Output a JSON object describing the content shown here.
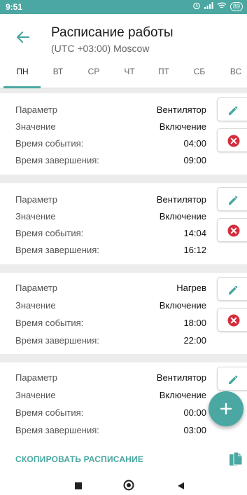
{
  "status": {
    "time": "9:51",
    "battery": "89"
  },
  "header": {
    "title": "Расписание работы",
    "subtitle": "(UTC +03:00) Moscow"
  },
  "tabs": [
    {
      "label": "ПН",
      "active": true
    },
    {
      "label": "ВТ"
    },
    {
      "label": "СР"
    },
    {
      "label": "ЧТ"
    },
    {
      "label": "ПТ"
    },
    {
      "label": "СБ"
    },
    {
      "label": "ВС"
    }
  ],
  "labels": {
    "param": "Параметр",
    "value": "Значение",
    "event_time": "Время события:",
    "end_time": "Время завершения:"
  },
  "events": [
    {
      "param": "Вентилятор",
      "value": "Включение",
      "event_time": "04:00",
      "end_time": "09:00"
    },
    {
      "param": "Вентилятор",
      "value": "Включение",
      "event_time": "14:04",
      "end_time": "16:12"
    },
    {
      "param": "Нагрев",
      "value": "Включение",
      "event_time": "18:00",
      "end_time": "22:00"
    },
    {
      "param": "Вентилятор",
      "value": "Включение",
      "event_time": "00:00",
      "end_time": "03:00"
    }
  ],
  "footer": {
    "copy_label": "СКОПИРОВАТЬ РАСПИСАНИЕ"
  },
  "colors": {
    "accent": "#4aa7a1",
    "delete": "#d32f3f",
    "status_bar": "#4aa7a1"
  },
  "icons": {
    "back": "arrow-left-icon",
    "edit": "pencil-icon",
    "delete": "close-circle-icon",
    "add": "plus-icon",
    "copy": "copy-icon"
  }
}
